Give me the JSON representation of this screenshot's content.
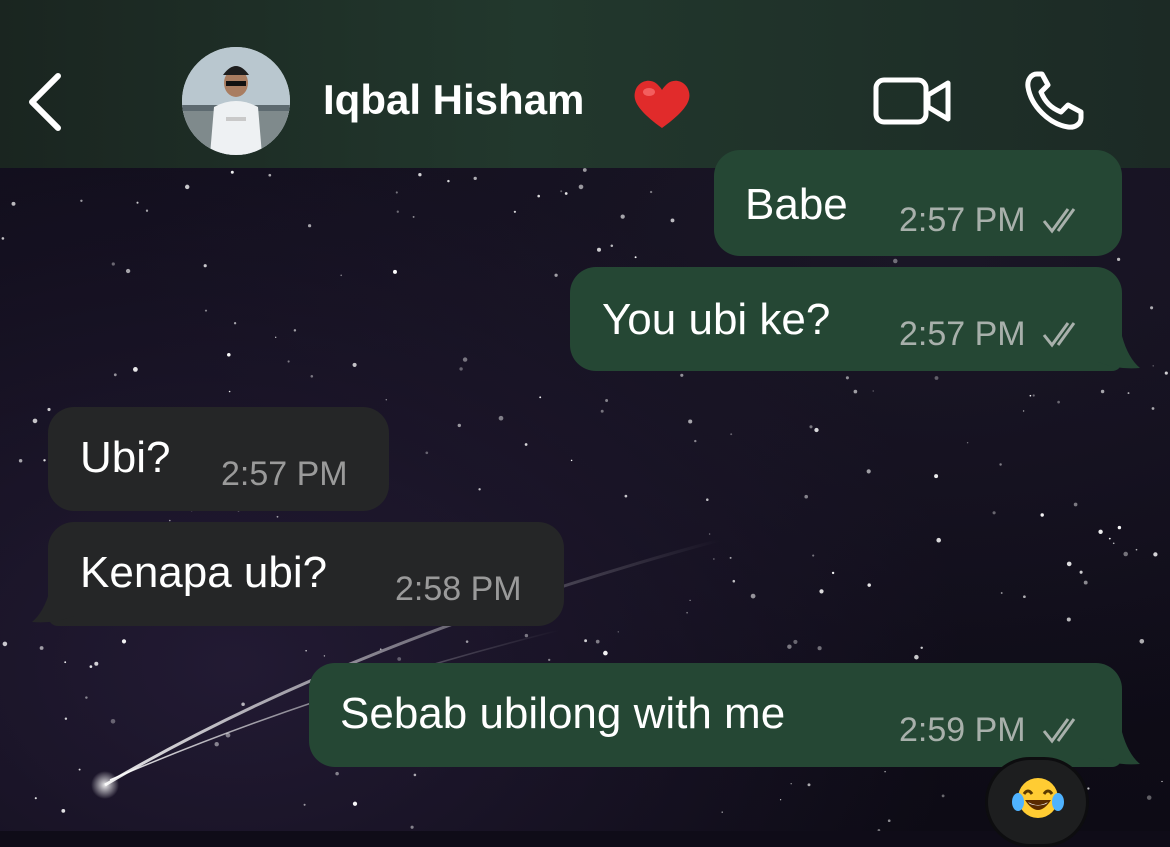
{
  "header": {
    "contact_name": "Iqbal Hisham",
    "back_icon": "chevron-left-icon",
    "heart_icon": "red-heart-emoji",
    "video_icon": "video-camera-icon",
    "call_icon": "phone-icon",
    "accent_color": "#22382d"
  },
  "messages": [
    {
      "direction": "outgoing",
      "text": "Babe",
      "time": "2:57 PM",
      "status": "read"
    },
    {
      "direction": "outgoing",
      "text": "You ubi ke?",
      "time": "2:57 PM",
      "status": "read"
    },
    {
      "direction": "incoming",
      "text": "Ubi?",
      "time": "2:57 PM"
    },
    {
      "direction": "incoming",
      "text": "Kenapa ubi?",
      "time": "2:58 PM"
    },
    {
      "direction": "outgoing",
      "text": "Sebab ubilong with me",
      "time": "2:59 PM",
      "status": "read"
    }
  ],
  "reaction": {
    "emoji": "😂",
    "icon": "laughing-tears-emoji"
  },
  "colors": {
    "outgoing_bubble": "#254734",
    "incoming_bubble": "#252627",
    "time_text": "#a8b0ab"
  }
}
